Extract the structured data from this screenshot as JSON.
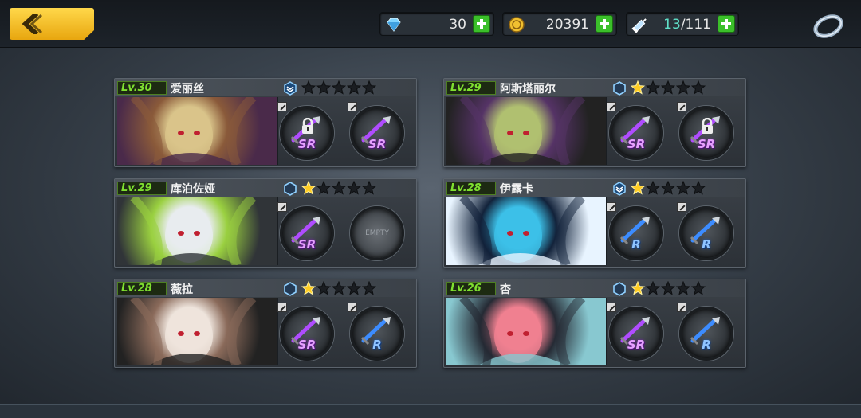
{
  "topbar": {
    "back_icon": "chevron-left-icon",
    "diamonds": {
      "icon": "diamond-icon",
      "value": "30"
    },
    "gold": {
      "icon": "gold-coin-icon",
      "value": "20391"
    },
    "stamina": {
      "icon": "syringe-icon",
      "current": "13",
      "max": "/111"
    },
    "settings_icon": "ring-icon"
  },
  "colors": {
    "back": "#f0b020",
    "level": "#7fe030",
    "star_on": "#ffcc22",
    "sr": "#b04cff",
    "r": "#3c8cff"
  },
  "cards": [
    {
      "level": "Lv.30",
      "name": "爱丽丝",
      "rank_icon": "rank-chevron-icon",
      "stars": 0,
      "slots": [
        {
          "rarity": "SR",
          "locked": true
        },
        {
          "rarity": "SR",
          "locked": false
        }
      ],
      "palette": [
        "#d9c48a",
        "#8a5a3a",
        "#4a2a4a"
      ]
    },
    {
      "level": "Lv.29",
      "name": "阿斯塔丽尔",
      "rank_icon": "rank-hex-icon",
      "stars": 1,
      "slots": [
        {
          "rarity": "SR",
          "locked": false
        },
        {
          "rarity": "SR",
          "locked": true
        }
      ],
      "palette": [
        "#b0c070",
        "#553366",
        "#222"
      ]
    },
    {
      "level": "Lv.29",
      "name": "库泊佐娅",
      "rank_icon": "rank-hex-icon",
      "stars": 1,
      "slots": [
        {
          "rarity": "SR",
          "locked": false
        },
        {
          "rarity": "",
          "empty": true,
          "empty_label": "EMPTY"
        }
      ],
      "palette": [
        "#e8ecef",
        "#9ad040",
        "#303438"
      ]
    },
    {
      "level": "Lv.28",
      "name": "伊露卡",
      "rank_icon": "rank-chevron-icon",
      "stars": 1,
      "slots": [
        {
          "rarity": "R",
          "locked": false
        },
        {
          "rarity": "R",
          "locked": false
        }
      ],
      "palette": [
        "#3cc0e8",
        "#12223a",
        "#e8f4ff"
      ]
    },
    {
      "level": "Lv.28",
      "name": "薇拉",
      "rank_icon": "rank-hex-icon",
      "stars": 1,
      "slots": [
        {
          "rarity": "SR",
          "locked": false
        },
        {
          "rarity": "R",
          "locked": false
        }
      ],
      "palette": [
        "#eee4dc",
        "#8a6a5a",
        "#222"
      ]
    },
    {
      "level": "Lv.26",
      "name": "杏",
      "rank_icon": "rank-hex-icon",
      "stars": 1,
      "slots": [
        {
          "rarity": "SR",
          "locked": false
        },
        {
          "rarity": "R",
          "locked": false
        }
      ],
      "palette": [
        "#f08090",
        "#252a34",
        "#88c8d0"
      ]
    }
  ]
}
